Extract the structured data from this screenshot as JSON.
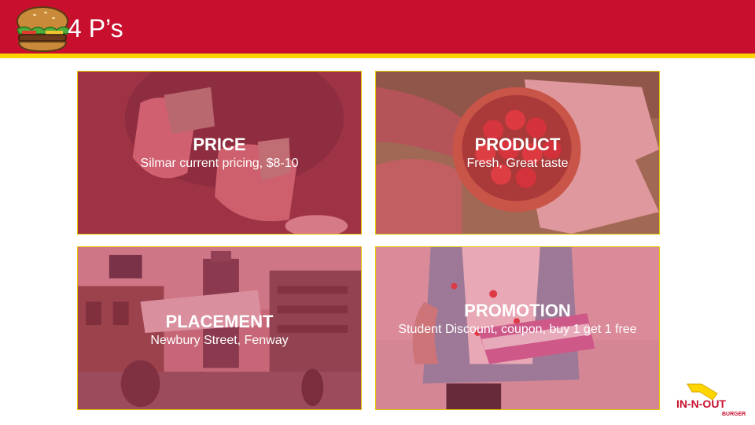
{
  "header": {
    "title": "4 P’s"
  },
  "cards": [
    {
      "title": "PRICE",
      "description": "Silmar current pricing, $8-10"
    },
    {
      "title": "PRODUCT",
      "description": "Fresh, Great taste"
    },
    {
      "title": "PLACEMENT",
      "description": "Newbury Street, Fenway"
    },
    {
      "title": "PROMOTION",
      "description": "Student Discount, coupon,  buy 1 get 1 free"
    }
  ],
  "logo": {
    "brand_line": "IN-N-OUT",
    "sub_line": "BURGER"
  },
  "colors": {
    "header_red": "#c8102e",
    "stripe_yellow": "#ffd500",
    "overlay_tint": "#d83a5a"
  }
}
